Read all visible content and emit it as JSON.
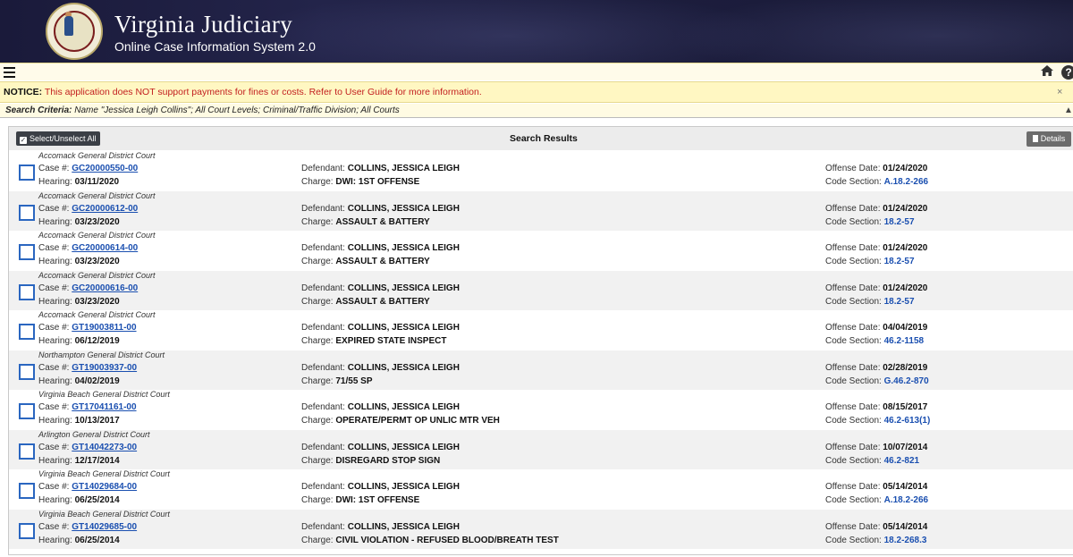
{
  "header": {
    "title": "Virginia Judiciary",
    "subtitle": "Online Case Information System 2.0"
  },
  "toolbar": {
    "menu_icon": "hamburger-menu-icon",
    "home_icon": "home-icon",
    "help_icon": "help-icon",
    "help_glyph": "?"
  },
  "notice": {
    "label": "NOTICE:",
    "message": "This application does NOT support payments for fines or costs. Refer to User Guide for more information.",
    "close": "×"
  },
  "criteria": {
    "label": "Search Criteria:",
    "text": "Name \"Jessica Leigh Collins\"; All Court Levels; Criminal/Traffic Division; All Courts",
    "caret": "▲"
  },
  "panel": {
    "select_all_label": "Select/Unselect All",
    "title": "Search Results",
    "details_label": "Details"
  },
  "labels": {
    "case": "Case #: ",
    "hearing": "Hearing: ",
    "defendant": "Defendant: ",
    "charge": "Charge: ",
    "offense_date": "Offense Date: ",
    "code_section": "Code Section: "
  },
  "results": [
    {
      "court": "Accomack General District Court",
      "case": "GC20000550-00",
      "hearing": "03/11/2020",
      "defendant": "COLLINS, JESSICA LEIGH",
      "charge": "DWI: 1ST OFFENSE",
      "offense_date": "01/24/2020",
      "code": "A.18.2-266"
    },
    {
      "court": "Accomack General District Court",
      "case": "GC20000612-00",
      "hearing": "03/23/2020",
      "defendant": "COLLINS, JESSICA LEIGH",
      "charge": "ASSAULT & BATTERY",
      "offense_date": "01/24/2020",
      "code": "18.2-57"
    },
    {
      "court": "Accomack General District Court",
      "case": "GC20000614-00",
      "hearing": "03/23/2020",
      "defendant": "COLLINS, JESSICA LEIGH",
      "charge": "ASSAULT & BATTERY",
      "offense_date": "01/24/2020",
      "code": "18.2-57"
    },
    {
      "court": "Accomack General District Court",
      "case": "GC20000616-00",
      "hearing": "03/23/2020",
      "defendant": "COLLINS, JESSICA LEIGH",
      "charge": "ASSAULT & BATTERY",
      "offense_date": "01/24/2020",
      "code": "18.2-57"
    },
    {
      "court": "Accomack General District Court",
      "case": "GT19003811-00",
      "hearing": "06/12/2019",
      "defendant": "COLLINS, JESSICA LEIGH",
      "charge": "EXPIRED STATE INSPECT",
      "offense_date": "04/04/2019",
      "code": "46.2-1158"
    },
    {
      "court": "Northampton General District Court",
      "case": "GT19003937-00",
      "hearing": "04/02/2019",
      "defendant": "COLLINS, JESSICA LEIGH",
      "charge": "71/55 SP",
      "offense_date": "02/28/2019",
      "code": "G.46.2-870"
    },
    {
      "court": "Virginia Beach General District Court",
      "case": "GT17041161-00",
      "hearing": "10/13/2017",
      "defendant": "COLLINS, JESSICA LEIGH",
      "charge": "OPERATE/PERMT OP UNLIC MTR VEH",
      "offense_date": "08/15/2017",
      "code": "46.2-613(1)"
    },
    {
      "court": "Arlington General District Court",
      "case": "GT14042273-00",
      "hearing": "12/17/2014",
      "defendant": "COLLINS, JESSICA LEIGH",
      "charge": "DISREGARD STOP SIGN",
      "offense_date": "10/07/2014",
      "code": "46.2-821"
    },
    {
      "court": "Virginia Beach General District Court",
      "case": "GT14029684-00",
      "hearing": "06/25/2014",
      "defendant": "COLLINS, JESSICA LEIGH",
      "charge": "DWI: 1ST OFFENSE",
      "offense_date": "05/14/2014",
      "code": "A.18.2-266"
    },
    {
      "court": "Virginia Beach General District Court",
      "case": "GT14029685-00",
      "hearing": "06/25/2014",
      "defendant": "COLLINS, JESSICA LEIGH",
      "charge": "CIVIL VIOLATION - REFUSED BLOOD/BREATH TEST",
      "offense_date": "05/14/2014",
      "code": "18.2-268.3"
    }
  ]
}
